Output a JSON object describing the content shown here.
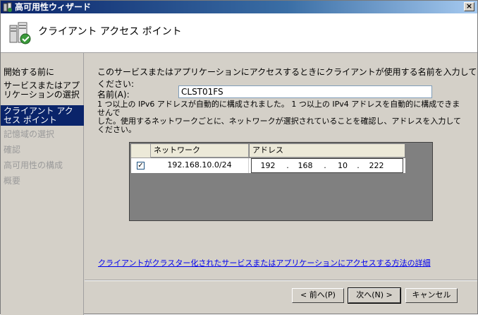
{
  "window": {
    "title": "高可用性ウィザード",
    "close_glyph": "×"
  },
  "header": {
    "title": "クライアント アクセス ポイント",
    "icon": "wizard-servers-icon"
  },
  "sidebar": {
    "items": [
      {
        "label": "開始する前に",
        "state": "normal"
      },
      {
        "label": "サービスまたはアプリケーションの選択",
        "state": "normal"
      },
      {
        "label": "クライアント アクセス ポイント",
        "state": "selected"
      },
      {
        "label": "記憶域の選択",
        "state": "disabled"
      },
      {
        "label": "確認",
        "state": "disabled"
      },
      {
        "label": "高可用性の構成",
        "state": "disabled"
      },
      {
        "label": "概要",
        "state": "disabled"
      }
    ]
  },
  "main": {
    "description": "このサービスまたはアプリケーションにアクセスするときにクライアントが使用する名前を入力してください:",
    "name_label": "名前(A):",
    "name_value": "CLST01FS",
    "note_line1": "1 つ以上の IPv6 アドレスが自動的に構成されました。 1 つ以上の IPv4 アドレスを自動的に構成できませんで",
    "note_line2": "した。使用するネットワークごとに、ネットワークが選択されていることを確認し、アドレスを入力してください。",
    "grid": {
      "headers": [
        "",
        "ネットワーク",
        "アドレス"
      ],
      "rows": [
        {
          "checked": true,
          "check_glyph": "✓",
          "network": "192.168.10.0/24",
          "address": [
            "192",
            "168",
            "10",
            "222"
          ]
        }
      ]
    },
    "help_link": "クライアントがクラスター化されたサービスまたはアプリケーションにアクセスする方法の詳細"
  },
  "buttons": {
    "back": "< 前へ(P)",
    "next": "次へ(N) >",
    "cancel": "キャンセル"
  },
  "colors": {
    "selection": "#0a246a",
    "link": "#0000ee",
    "dialog_bg": "#d4d0c8"
  }
}
